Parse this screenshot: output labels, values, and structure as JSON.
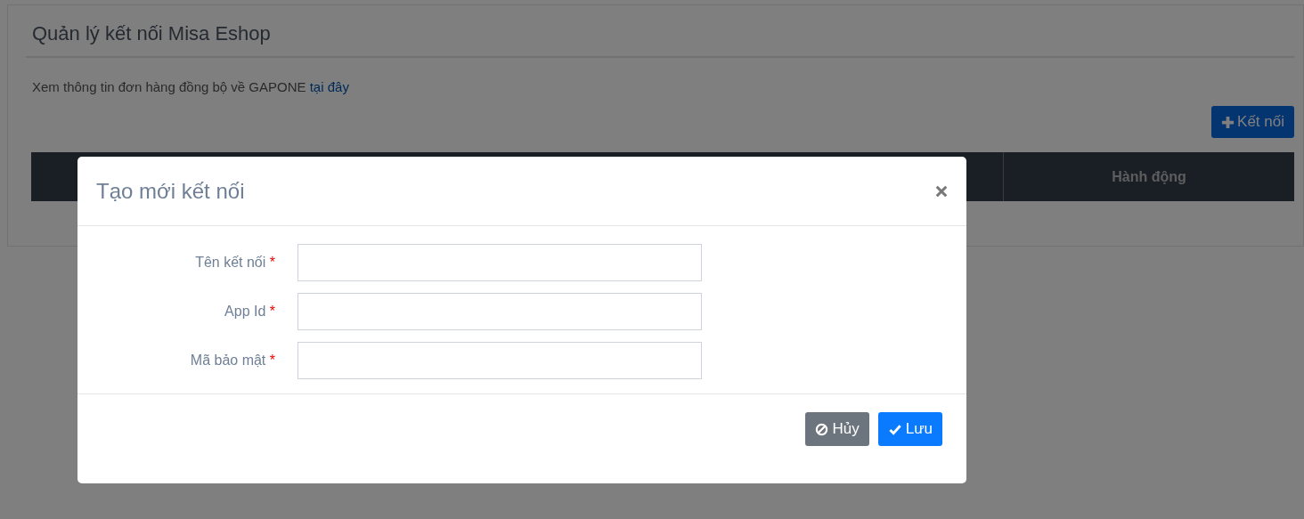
{
  "page": {
    "title": "Quản lý kết nối Misa Eshop",
    "info_text": "Xem thông tin đơn hàng đồng bộ về GAPONE",
    "info_link": "tại đây",
    "add_button": "Kết nối"
  },
  "table": {
    "columns": [
      {
        "label": "Hành động"
      }
    ]
  },
  "modal": {
    "title": "Tạo mới kết nối",
    "fields": [
      {
        "label": "Tên kết nối",
        "required_mark": "*"
      },
      {
        "label": "App Id",
        "required_mark": "*"
      },
      {
        "label": "Mã bảo mật",
        "required_mark": "*"
      }
    ],
    "buttons": [
      {
        "kind": "cancel",
        "label": "Hủy"
      },
      {
        "kind": "save",
        "label": "Lưu"
      }
    ]
  }
}
